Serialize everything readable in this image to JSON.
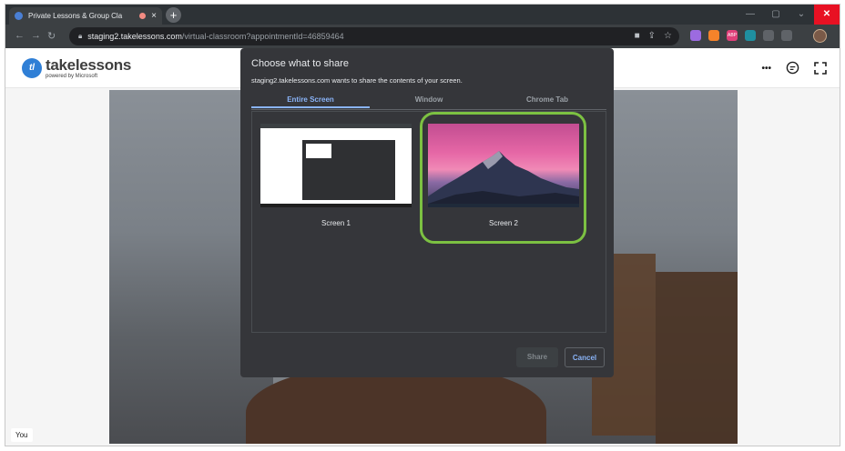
{
  "browser": {
    "tab_title": "Private Lessons & Group Cla",
    "tab_close": "×",
    "new_tab": "+",
    "window_controls": {
      "minimize": "—",
      "maximize": "▢",
      "close": "✕"
    },
    "url_host": "staging2.takelessons.com",
    "url_path": "/virtual-classroom?appointmentId=46859464",
    "extensions": [
      {
        "name": "extension-icon-purple",
        "color": "#9c6be0"
      },
      {
        "name": "extension-icon-orange",
        "color": "#f5832a"
      },
      {
        "name": "adblock-icon",
        "color": "#e0407a",
        "label": "ABP"
      },
      {
        "name": "extension-icon-teal",
        "color": "#1f8fa0"
      },
      {
        "name": "extension-icon-grey",
        "color": "#5f6368"
      }
    ]
  },
  "site": {
    "logo_mark": "tl",
    "logo_name": "takelessons",
    "logo_sub": "powered by Microsoft",
    "more_label": "•••"
  },
  "video": {
    "self_label": "You"
  },
  "dialog": {
    "title": "Choose what to share",
    "subtitle": "staging2.takelessons.com wants to share the contents of your screen.",
    "tabs": [
      {
        "label": "Entire Screen",
        "active": true
      },
      {
        "label": "Window",
        "active": false
      },
      {
        "label": "Chrome Tab",
        "active": false
      }
    ],
    "screens": [
      {
        "label": "Screen 1"
      },
      {
        "label": "Screen 2",
        "selected": true
      }
    ],
    "share_label": "Share",
    "cancel_label": "Cancel",
    "accent_color": "#8ab4f8",
    "selection_color": "#7cc142"
  }
}
